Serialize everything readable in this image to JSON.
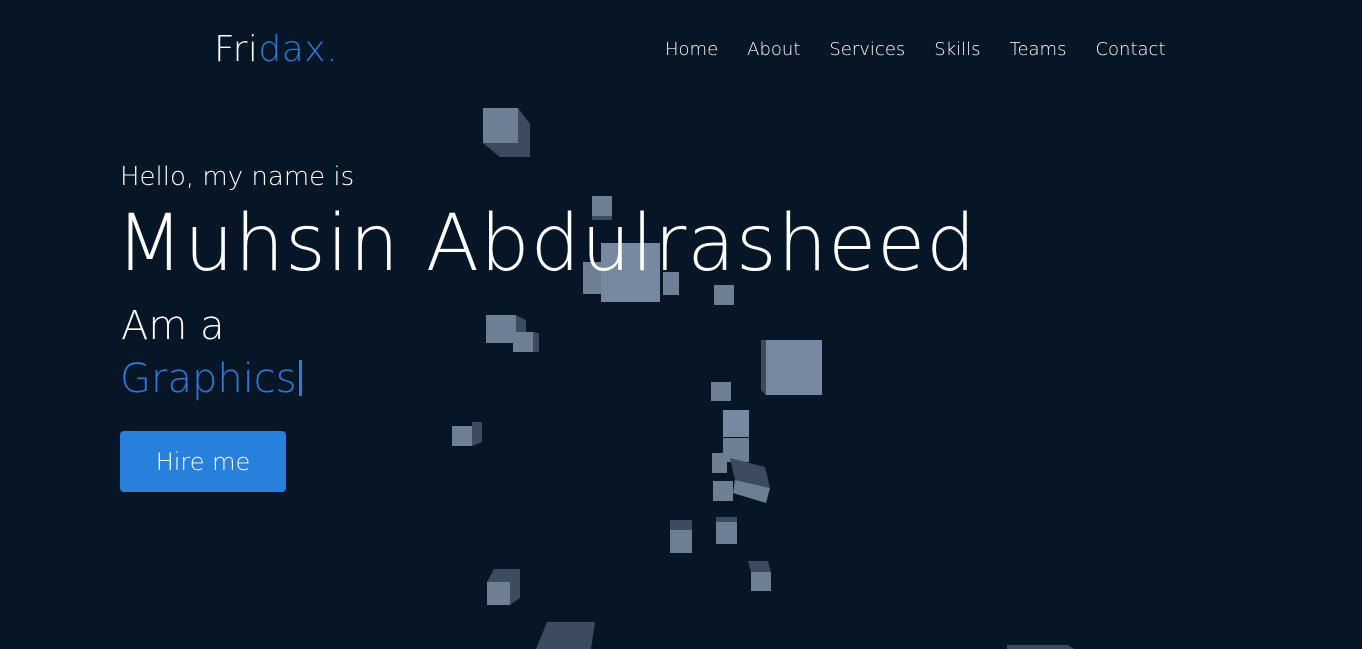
{
  "header": {
    "logo_main": "Fri",
    "logo_accent": "dax.",
    "nav": [
      "Home",
      "About",
      "Services",
      "Skills",
      "Teams",
      "Contact"
    ]
  },
  "hero": {
    "greeting": "Hello, my name is",
    "name": "Muhsin Abdulrasheed",
    "intro": "Am a",
    "role": "Graphics",
    "cta_label": "Hire me"
  },
  "colors": {
    "background": "#061627",
    "accent": "#2a7ad8",
    "button": "#2680dc",
    "text": "#ffffff",
    "cube_face": "#6e7f93",
    "cube_side": "#3c4b5d"
  }
}
